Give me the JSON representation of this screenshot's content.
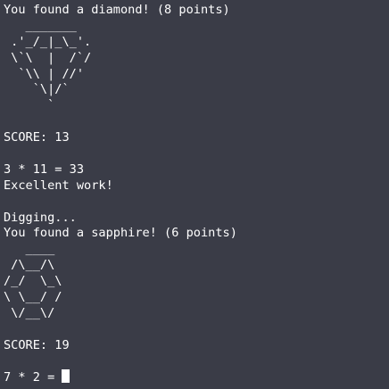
{
  "terminal": {
    "lines": [
      "You found a diamond! (8 points)",
      "   _______",
      " .'_/_|_\\_'.",
      " \\`\\  |  /`/",
      "  `\\\\ | //'",
      "    `\\|/`",
      "      `",
      "",
      "SCORE: 13",
      "",
      "3 * 11 = 33",
      "Excellent work!",
      "",
      "Digging...",
      "You found a sapphire! (6 points)",
      "   ____",
      " /\\__/\\",
      "/_/  \\_\\",
      "\\ \\__/ /",
      " \\/__\\/",
      "",
      "SCORE: 19",
      ""
    ],
    "prompt": "7 * 2 = "
  }
}
